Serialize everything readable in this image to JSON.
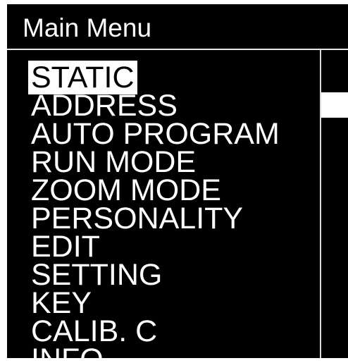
{
  "header": {
    "title": "Main Menu"
  },
  "menu": {
    "selected_index": 0,
    "items": [
      {
        "label": "STATIC"
      },
      {
        "label": "ADDRESS"
      },
      {
        "label": "AUTO PROGRAM"
      },
      {
        "label": "RUN MODE"
      },
      {
        "label": "ZOOM MODE"
      },
      {
        "label": "PERSONALITY"
      },
      {
        "label": "EDIT"
      },
      {
        "label": "SETTING"
      },
      {
        "label": "KEY"
      },
      {
        "label": "CALIB. C"
      },
      {
        "label": "INFO"
      }
    ]
  },
  "colors": {
    "background": "#000000",
    "text": "#ffffff",
    "highlight_bg": "#ffffff",
    "highlight_text": "#000000"
  }
}
